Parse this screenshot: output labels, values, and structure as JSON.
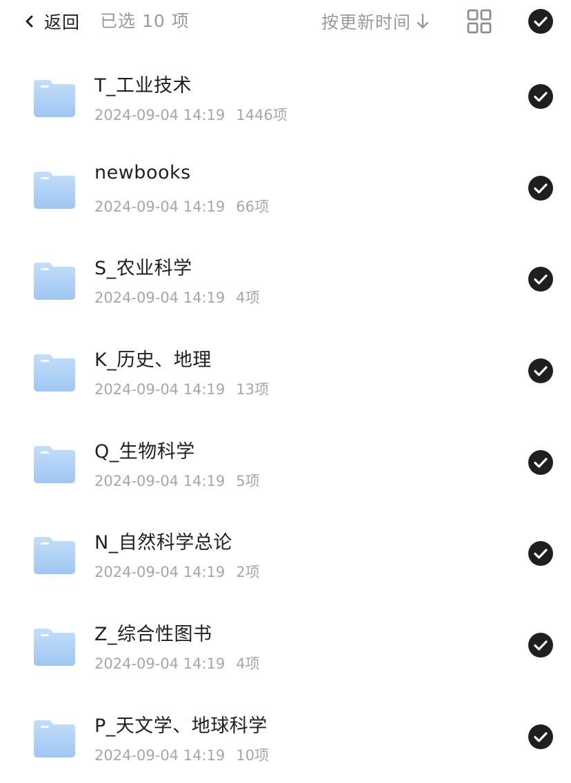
{
  "header": {
    "back_label": "返回",
    "selected_count": "已选 10 项",
    "sort_label": "按更新时间",
    "icons": {
      "back": "chevron-left-icon",
      "sort_direction": "arrow-down-icon",
      "view": "grid-view-icon",
      "select_all": "check-circle-icon"
    }
  },
  "colors": {
    "folder": "#a9cff7",
    "check_fill": "#1f1f1f",
    "text_primary": "#1f1f1f",
    "text_secondary": "#a6a6a6"
  },
  "folders": [
    {
      "name": "T_工业技术",
      "date": "2024-09-04 14:19",
      "count": "1446项"
    },
    {
      "name": "newbooks",
      "date": "2024-09-04 14:19",
      "count": "66项"
    },
    {
      "name": "S_农业科学",
      "date": "2024-09-04 14:19",
      "count": "4项"
    },
    {
      "name": "K_历史、地理",
      "date": "2024-09-04 14:19",
      "count": "13项"
    },
    {
      "name": "Q_生物科学",
      "date": "2024-09-04 14:19",
      "count": "5项"
    },
    {
      "name": "N_自然科学总论",
      "date": "2024-09-04 14:19",
      "count": "2项"
    },
    {
      "name": "Z_综合性图书",
      "date": "2024-09-04 14:19",
      "count": "4项"
    },
    {
      "name": "P_天文学、地球科学",
      "date": "2024-09-04 14:19",
      "count": "10项"
    }
  ]
}
